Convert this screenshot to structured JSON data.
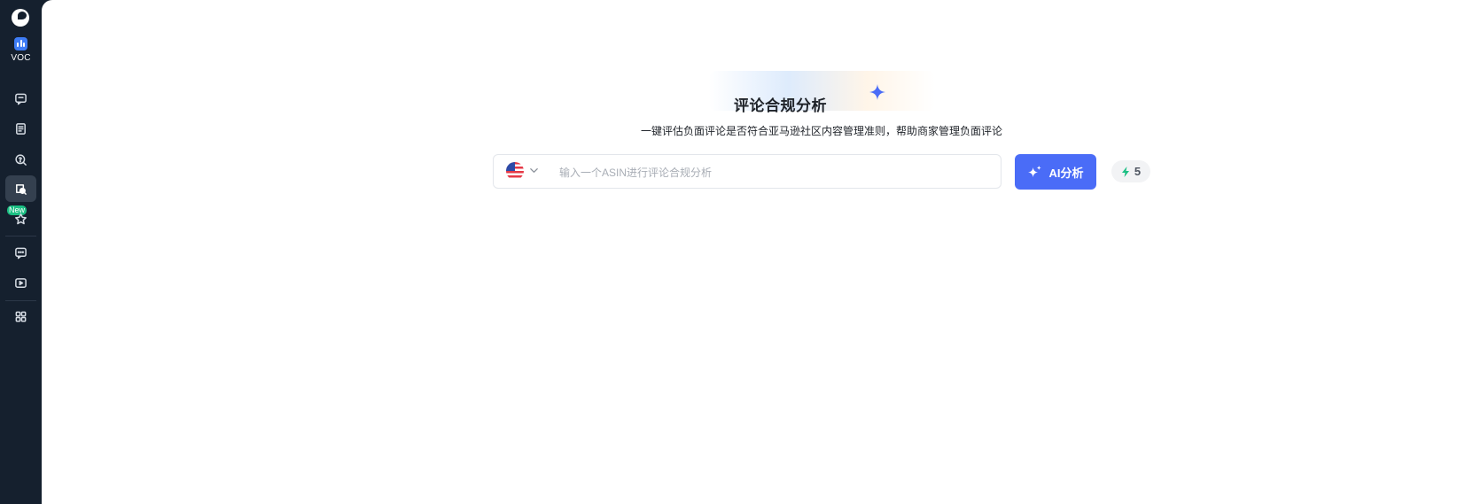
{
  "sidebar": {
    "app_label": "VOC",
    "new_badge": "New",
    "items": [
      {
        "icon": "message-square-icon"
      },
      {
        "icon": "document-icon"
      },
      {
        "icon": "search-question-icon"
      },
      {
        "icon": "review-compliance-icon",
        "active": true
      },
      {
        "icon": "star-icon"
      },
      {
        "icon": "chat-dots-icon"
      },
      {
        "icon": "video-play-icon"
      },
      {
        "icon": "grid-apps-icon"
      }
    ]
  },
  "main": {
    "title": "评论合规分析",
    "subtitle": "一键评估负面评论是否符合亚马逊社区内容管理准则，帮助商家管理负面评论",
    "search": {
      "placeholder": "输入一个ASIN进行评论合规分析",
      "value": "",
      "marketplace_icon": "us-flag-icon"
    },
    "analyze_button": "AI分析",
    "credits": "5"
  },
  "colors": {
    "sidebar_bg": "#15202e",
    "accent": "#4a6cf7",
    "badge_green": "#1bbf83"
  }
}
